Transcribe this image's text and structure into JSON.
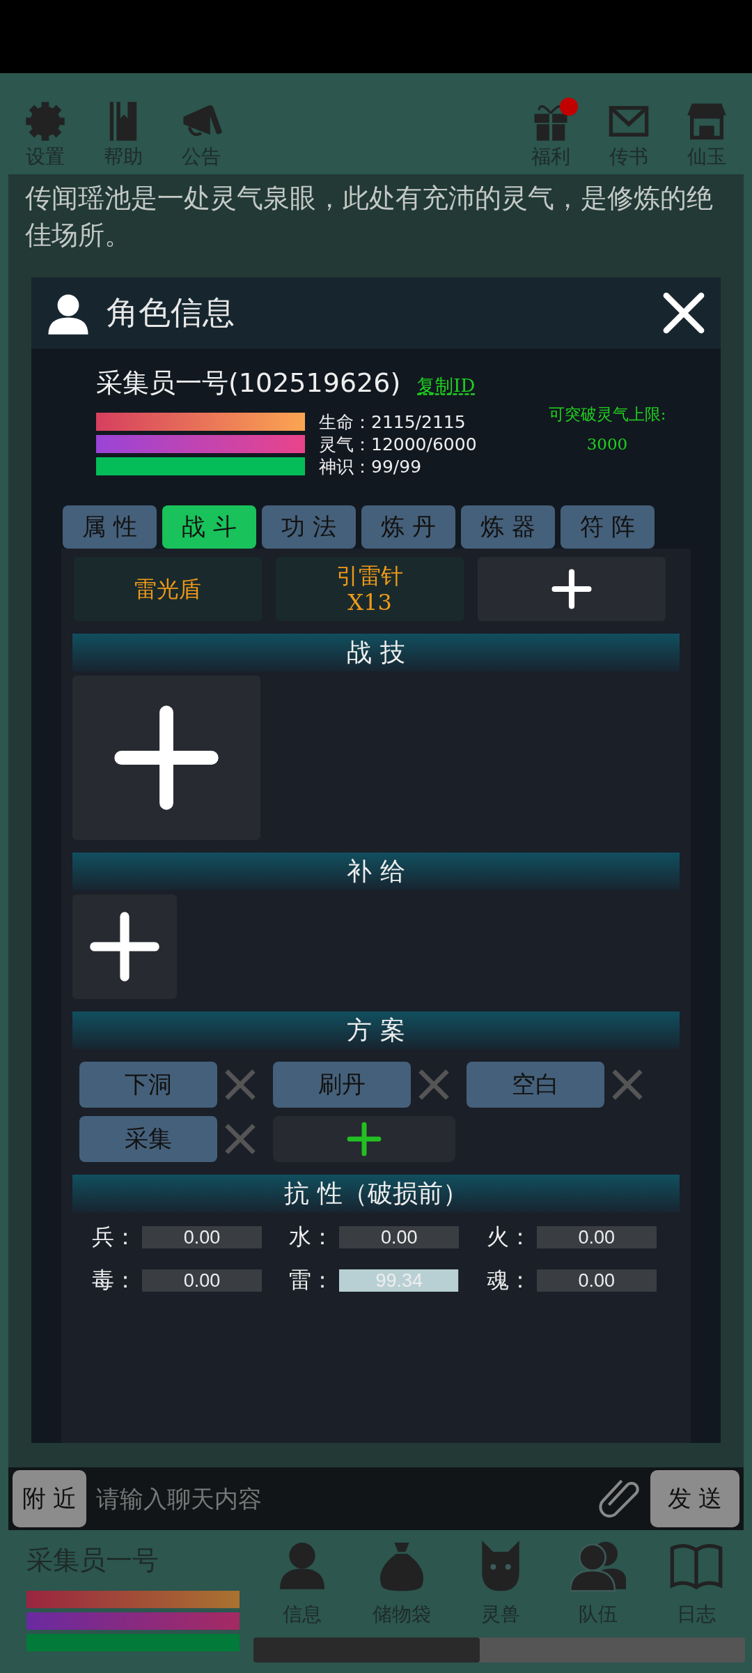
{
  "toolbar_left": [
    {
      "label": "设置"
    },
    {
      "label": "帮助"
    },
    {
      "label": "公告"
    }
  ],
  "toolbar_right": [
    {
      "label": "福利",
      "notification": true
    },
    {
      "label": "传书",
      "notification": false
    },
    {
      "label": "仙玉",
      "notification": false
    }
  ],
  "intro_text": "传闻瑶池是一处灵气泉眼，此处有充沛的灵气，是修炼的绝佳场所。",
  "dialog": {
    "title": "角色信息",
    "player": {
      "name": "采集员一号(102519626)",
      "copy_link": "复制ID",
      "stats": [
        {
          "label": "生命：",
          "value": "2115/2115",
          "level": 1
        },
        {
          "label": "灵气：",
          "value": "12000/6000",
          "level": 1
        },
        {
          "label": "神识：",
          "value": "99/99",
          "level": 1
        }
      ],
      "breakthrough_label": "可突破灵气上限:",
      "breakthrough_value": "3000"
    },
    "tabs": [
      {
        "label": "属 性",
        "selected": false
      },
      {
        "label": "战 斗",
        "selected": true
      },
      {
        "label": "功 法",
        "selected": false
      },
      {
        "label": "炼 丹",
        "selected": false
      },
      {
        "label": "炼 器",
        "selected": false
      },
      {
        "label": "符 阵",
        "selected": false
      }
    ],
    "equipment_slots": [
      {
        "kind": "item",
        "lines": [
          "雷光盾"
        ]
      },
      {
        "kind": "item",
        "lines": [
          "引雷针",
          "X13"
        ]
      },
      {
        "kind": "add"
      }
    ],
    "skills": {
      "title": "战 技"
    },
    "supplies": {
      "title": "补 给"
    },
    "plans": {
      "title": "方 案",
      "items": [
        {
          "name": "下洞"
        },
        {
          "name": "刷丹"
        },
        {
          "name": "空白"
        },
        {
          "name": "采集"
        }
      ]
    },
    "resistance": {
      "title": "抗 性（破损前）",
      "items": [
        {
          "label": "兵：",
          "value": "0.00",
          "level": 0
        },
        {
          "label": "水：",
          "value": "0.00",
          "level": 0
        },
        {
          "label": "火：",
          "value": "0.00",
          "level": 0
        },
        {
          "label": "毒：",
          "value": "0.00",
          "level": 0
        },
        {
          "label": "雷：",
          "value": "99.34",
          "level": 0.9934
        },
        {
          "label": "魂：",
          "value": "0.00",
          "level": 0
        }
      ]
    }
  },
  "chat": {
    "channel": "附 近",
    "placeholder": "请输入聊天内容",
    "send": "发 送"
  },
  "bottom": {
    "player_name": "采集员一号",
    "bars": [
      {
        "level": 1
      },
      {
        "level": 1
      },
      {
        "level": 1
      }
    ],
    "nav": [
      {
        "label": "信息"
      },
      {
        "label": "储物袋"
      },
      {
        "label": "灵兽"
      },
      {
        "label": "队伍"
      },
      {
        "label": "日志"
      }
    ],
    "progress": {
      "level": 0.46
    }
  }
}
